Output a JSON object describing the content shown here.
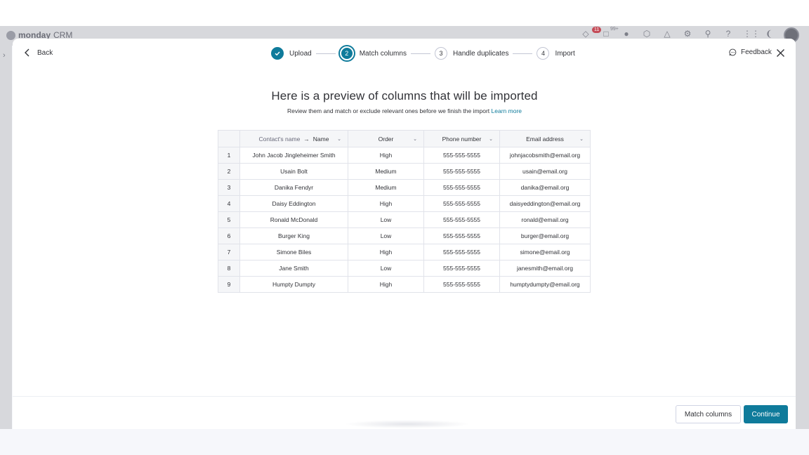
{
  "app": {
    "logo_text": "monday",
    "logo_suffix": "CRM",
    "notification_count": "11",
    "inbox_count": "99+"
  },
  "header": {
    "back_label": "Back",
    "feedback_label": "Feedback"
  },
  "steps": [
    {
      "number": "1",
      "label": "Upload",
      "state": "done"
    },
    {
      "number": "2",
      "label": "Match columns",
      "state": "active"
    },
    {
      "number": "3",
      "label": "Handle duplicates",
      "state": "pending"
    },
    {
      "number": "4",
      "label": "Import",
      "state": "pending"
    }
  ],
  "main": {
    "title": "Here is a preview of columns that will be imported",
    "subtitle": "Review them and match or exclude relevant ones before we finish the import",
    "learn_more": "Learn more"
  },
  "table": {
    "source_column": "Contact's name",
    "headers": [
      "Name",
      "Order",
      "Phone number",
      "Email address"
    ],
    "rows": [
      [
        "1",
        "John Jacob Jingleheimer Smith",
        "High",
        "555-555-5555",
        "johnjacobsmith@email.org"
      ],
      [
        "2",
        "Usain Bolt",
        "Medium",
        "555-555-5555",
        "usain@email.org"
      ],
      [
        "3",
        "Danika Fendyr",
        "Medium",
        "555-555-5555",
        "danika@email.org"
      ],
      [
        "4",
        "Daisy Eddington",
        "High",
        "555-555-5555",
        "daisyeddington@email.org"
      ],
      [
        "5",
        "Ronald McDonald",
        "Low",
        "555-555-5555",
        "ronald@email.org"
      ],
      [
        "6",
        "Burger King",
        "Low",
        "555-555-5555",
        "burger@email.org"
      ],
      [
        "7",
        "Simone Biles",
        "High",
        "555-555-5555",
        "simone@email.org"
      ],
      [
        "8",
        "Jane Smith",
        "Low",
        "555-555-5555",
        "janesmith@email.org"
      ],
      [
        "9",
        "Humpty Dumpty",
        "High",
        "555-555-5555",
        "humptydumpty@email.org"
      ]
    ]
  },
  "footer": {
    "secondary_label": "Match columns",
    "primary_label": "Continue"
  },
  "colors": {
    "accent": "#0f7b9b",
    "text": "#323338",
    "border": "#e1e3ea"
  }
}
